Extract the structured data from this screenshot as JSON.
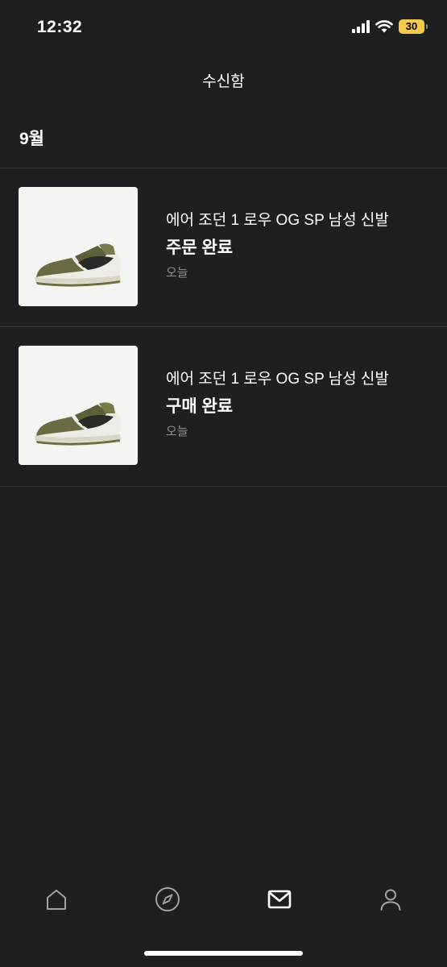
{
  "status_bar": {
    "time": "12:32",
    "battery": "30"
  },
  "header": {
    "title": "수신함"
  },
  "section": {
    "month": "9월"
  },
  "notifications": [
    {
      "product": "에어 조던 1 로우 OG SP 남성 신발",
      "title": "주문 완료",
      "time": "오늘",
      "image_icon": "sneaker-image"
    },
    {
      "product": "에어 조던 1 로우 OG SP 남성 신발",
      "title": "구매 완료",
      "time": "오늘",
      "image_icon": "sneaker-image"
    }
  ],
  "tab_bar": {
    "tabs": [
      {
        "icon": "home-icon",
        "active": false
      },
      {
        "icon": "compass-icon",
        "active": false
      },
      {
        "icon": "inbox-mail-icon",
        "active": true
      },
      {
        "icon": "profile-icon",
        "active": false
      }
    ]
  },
  "colors": {
    "background": "#1f1f21",
    "divider": "#3a3a3c",
    "secondary_text": "#8e8e93",
    "battery": "#f5c94a",
    "inactive_icon": "#a0a0a5",
    "active_icon": "#ffffff"
  }
}
